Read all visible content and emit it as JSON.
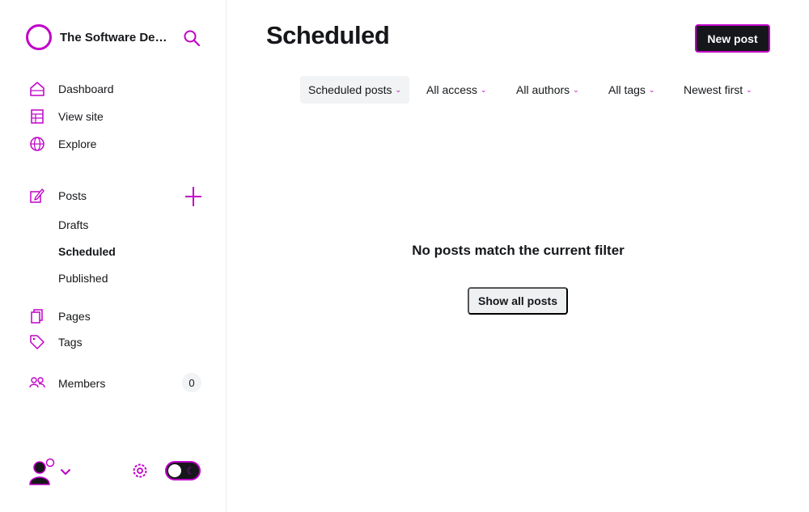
{
  "brand": {
    "name": "The Software Developer's Studio"
  },
  "nav": {
    "dashboard": "Dashboard",
    "view_site": "View site",
    "explore": "Explore",
    "posts": "Posts",
    "drafts": "Drafts",
    "scheduled": "Scheduled",
    "published": "Published",
    "pages": "Pages",
    "tags": "Tags",
    "members": "Members",
    "members_count": "0"
  },
  "header": {
    "title": "Scheduled",
    "new_post_label": "New post"
  },
  "filters": {
    "type": "Scheduled posts",
    "access": "All access",
    "authors": "All authors",
    "tags": "All tags",
    "order": "Newest first"
  },
  "empty_state": {
    "message": "No posts match the current filter",
    "button_label": "Show all posts"
  },
  "colors": {
    "accent": "#c100c8",
    "text": "#15171a",
    "muted_bg": "#f1f3f4"
  }
}
